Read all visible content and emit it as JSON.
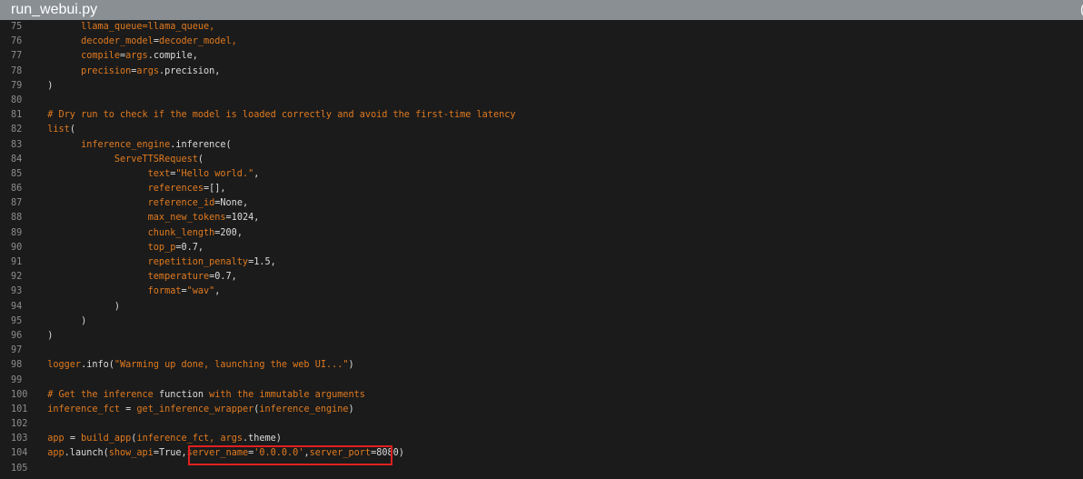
{
  "window": {
    "title": "run_webui.py",
    "corner_glyph": "("
  },
  "lines": [
    {
      "num": "75",
      "segments": [
        {
          "t": "        llama_queue=llama_queue,",
          "c": "o"
        }
      ]
    },
    {
      "num": "76",
      "segments": [
        {
          "t": "        decoder_model",
          "c": "o"
        },
        {
          "t": "=",
          "c": "w"
        },
        {
          "t": "decoder_model,",
          "c": "o"
        }
      ]
    },
    {
      "num": "77",
      "segments": [
        {
          "t": "        compile",
          "c": "o"
        },
        {
          "t": "=",
          "c": "w"
        },
        {
          "t": "args",
          "c": "o"
        },
        {
          "t": ".compile,",
          "c": "w"
        }
      ]
    },
    {
      "num": "78",
      "segments": [
        {
          "t": "        precision",
          "c": "o"
        },
        {
          "t": "=",
          "c": "w"
        },
        {
          "t": "args",
          "c": "o"
        },
        {
          "t": ".precision,",
          "c": "w"
        }
      ]
    },
    {
      "num": "79",
      "segments": [
        {
          "t": "  )",
          "c": "w"
        }
      ]
    },
    {
      "num": "80",
      "segments": []
    },
    {
      "num": "81",
      "segments": [
        {
          "t": "  # Dry run to check if the model is loaded correctly and avoid the first-time latency",
          "c": "c"
        }
      ]
    },
    {
      "num": "82",
      "segments": [
        {
          "t": "  list",
          "c": "o"
        },
        {
          "t": "(",
          "c": "w"
        }
      ]
    },
    {
      "num": "83",
      "segments": [
        {
          "t": "        inference_engine",
          "c": "o"
        },
        {
          "t": ".inference(",
          "c": "w"
        }
      ]
    },
    {
      "num": "84",
      "segments": [
        {
          "t": "              ServeTTSRequest",
          "c": "o"
        },
        {
          "t": "(",
          "c": "w"
        }
      ]
    },
    {
      "num": "85",
      "segments": [
        {
          "t": "                    text",
          "c": "o"
        },
        {
          "t": "=",
          "c": "w"
        },
        {
          "t": "\"Hello world.\"",
          "c": "o"
        },
        {
          "t": ",",
          "c": "w"
        }
      ]
    },
    {
      "num": "86",
      "segments": [
        {
          "t": "                    references",
          "c": "o"
        },
        {
          "t": "=[],",
          "c": "w"
        }
      ]
    },
    {
      "num": "87",
      "segments": [
        {
          "t": "                    reference_id",
          "c": "o"
        },
        {
          "t": "=None,",
          "c": "w"
        }
      ]
    },
    {
      "num": "88",
      "segments": [
        {
          "t": "                    max_new_tokens",
          "c": "o"
        },
        {
          "t": "=1024,",
          "c": "w"
        }
      ]
    },
    {
      "num": "89",
      "segments": [
        {
          "t": "                    chunk_length",
          "c": "o"
        },
        {
          "t": "=200,",
          "c": "w"
        }
      ]
    },
    {
      "num": "90",
      "segments": [
        {
          "t": "                    top_p",
          "c": "o"
        },
        {
          "t": "=0.7,",
          "c": "w"
        }
      ]
    },
    {
      "num": "91",
      "segments": [
        {
          "t": "                    repetition_penalty",
          "c": "o"
        },
        {
          "t": "=1.5,",
          "c": "w"
        }
      ]
    },
    {
      "num": "92",
      "segments": [
        {
          "t": "                    temperature",
          "c": "o"
        },
        {
          "t": "=0.7,",
          "c": "w"
        }
      ]
    },
    {
      "num": "93",
      "segments": [
        {
          "t": "                    format",
          "c": "o"
        },
        {
          "t": "=",
          "c": "w"
        },
        {
          "t": "\"wav\"",
          "c": "o"
        },
        {
          "t": ",",
          "c": "w"
        }
      ]
    },
    {
      "num": "94",
      "segments": [
        {
          "t": "              )",
          "c": "w"
        }
      ]
    },
    {
      "num": "95",
      "segments": [
        {
          "t": "        )",
          "c": "w"
        }
      ]
    },
    {
      "num": "96",
      "segments": [
        {
          "t": "  )",
          "c": "w"
        }
      ]
    },
    {
      "num": "97",
      "segments": []
    },
    {
      "num": "98",
      "segments": [
        {
          "t": "  logger",
          "c": "o"
        },
        {
          "t": ".info(",
          "c": "w"
        },
        {
          "t": "\"Warming up done, launching the web UI...\"",
          "c": "o"
        },
        {
          "t": ")",
          "c": "w"
        }
      ]
    },
    {
      "num": "99",
      "segments": []
    },
    {
      "num": "100",
      "segments": [
        {
          "t": "  # Get the inference ",
          "c": "c"
        },
        {
          "t": "function",
          "c": "w"
        },
        {
          "t": " with the immutable arguments",
          "c": "c"
        }
      ]
    },
    {
      "num": "101",
      "segments": [
        {
          "t": "  inference_fct ",
          "c": "o"
        },
        {
          "t": "= ",
          "c": "w"
        },
        {
          "t": "get_inference_wrapper",
          "c": "o"
        },
        {
          "t": "(",
          "c": "w"
        },
        {
          "t": "inference_engine",
          "c": "o"
        },
        {
          "t": ")",
          "c": "w"
        }
      ]
    },
    {
      "num": "102",
      "segments": []
    },
    {
      "num": "103",
      "segments": [
        {
          "t": "  app ",
          "c": "o"
        },
        {
          "t": "= ",
          "c": "w"
        },
        {
          "t": "build_app",
          "c": "o"
        },
        {
          "t": "(",
          "c": "w"
        },
        {
          "t": "inference_fct, args",
          "c": "o"
        },
        {
          "t": ".theme)",
          "c": "w"
        }
      ]
    },
    {
      "num": "104",
      "segments": [
        {
          "t": "  app",
          "c": "o"
        },
        {
          "t": ".launch(",
          "c": "w"
        },
        {
          "t": "show_api",
          "c": "o"
        },
        {
          "t": "=True,",
          "c": "w"
        },
        {
          "t": "server_name",
          "c": "o"
        },
        {
          "t": "=",
          "c": "w"
        },
        {
          "t": "'0.0.0.0'",
          "c": "o"
        },
        {
          "t": ",",
          "c": "w"
        },
        {
          "t": "server_port",
          "c": "o"
        },
        {
          "t": "=8080)",
          "c": "w"
        }
      ]
    },
    {
      "num": "105",
      "segments": []
    }
  ]
}
